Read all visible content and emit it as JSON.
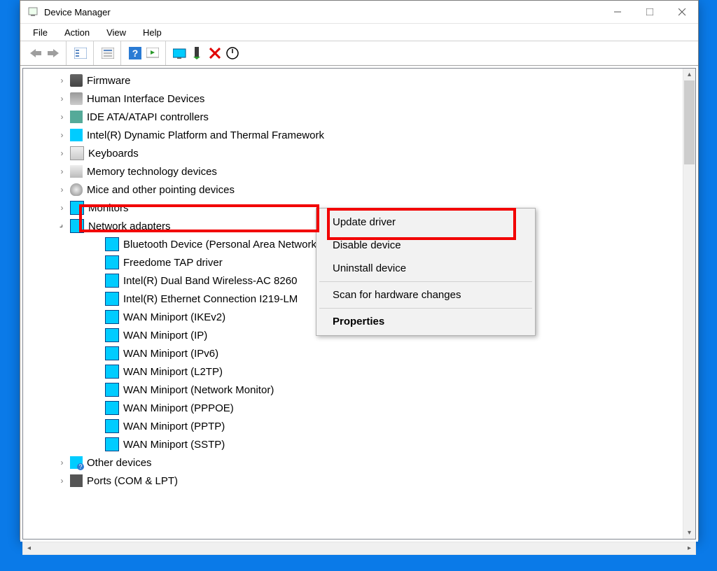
{
  "window": {
    "title": "Device Manager"
  },
  "menubar": {
    "file": "File",
    "action": "Action",
    "view": "View",
    "help": "Help"
  },
  "tree": {
    "cat0": "Firmware",
    "cat1": "Human Interface Devices",
    "cat2": "IDE ATA/ATAPI controllers",
    "cat3": "Intel(R) Dynamic Platform and Thermal Framework",
    "cat4": "Keyboards",
    "cat5": "Memory technology devices",
    "cat6": "Mice and other pointing devices",
    "cat7": "Monitors",
    "cat8": "Network adapters",
    "net0": "Bluetooth Device (Personal Area Network)",
    "net1": "Freedome TAP driver",
    "net2": "Intel(R) Dual Band Wireless-AC 8260",
    "net3": "Intel(R) Ethernet Connection I219-LM",
    "net4": "WAN Miniport (IKEv2)",
    "net5": "WAN Miniport (IP)",
    "net6": "WAN Miniport (IPv6)",
    "net7": "WAN Miniport (L2TP)",
    "net8": "WAN Miniport (Network Monitor)",
    "net9": "WAN Miniport (PPPOE)",
    "net10": "WAN Miniport (PPTP)",
    "net11": "WAN Miniport (SSTP)",
    "cat9": "Other devices",
    "cat10": "Ports (COM & LPT)"
  },
  "context_menu": {
    "update": "Update driver",
    "disable": "Disable device",
    "uninstall": "Uninstall device",
    "scan": "Scan for hardware changes",
    "properties": "Properties"
  }
}
